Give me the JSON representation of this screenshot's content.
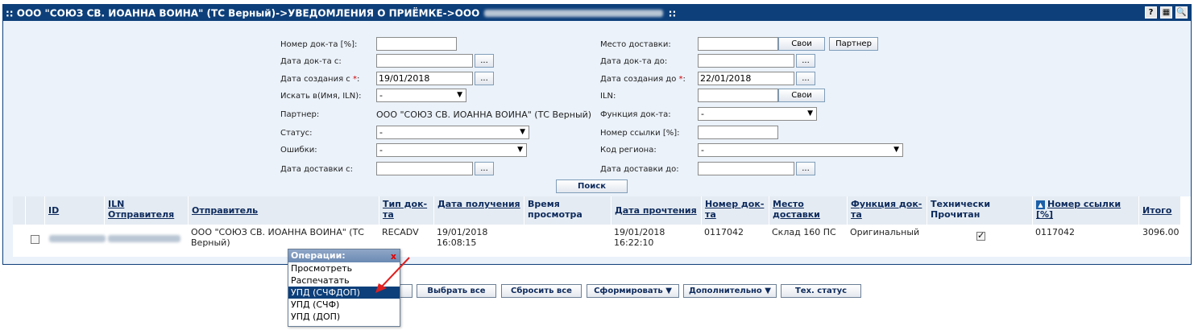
{
  "header": {
    "title_prefix": ":: ООО \"СОЮЗ СВ. ИОАННА ВОИНА\" (ТС Верный)->УВЕДОМЛЕНИЯ О ПРИЁМКЕ->ООО",
    "title_suffix": "::",
    "help_icon": "?",
    "grid_icon": "▦",
    "search_icon": "🔍"
  },
  "filters": {
    "doc_number_label": "Номер док-та [%]:",
    "doc_date_from_label": "Дата док-та с:",
    "created_from_label": "Дата создания с",
    "created_from_value": "19/01/2018",
    "search_in_label": "Искать в(Имя, ILN):",
    "search_in_value": "-",
    "partner_label": "Партнер:",
    "partner_value": "ООО \"СОЮЗ СВ. ИОАННА ВОИНА\" (ТС Верный)",
    "status_label": "Статус:",
    "status_value": "-",
    "errors_label": "Ошибки:",
    "errors_value": "-",
    "delivery_from_label": "Дата доставки с:",
    "delivery_place_label": "Место доставки:",
    "own_button": "Свои",
    "partner_button": "Партнер",
    "doc_date_to_label": "Дата док-та до:",
    "created_to_label": "Дата создания до",
    "created_to_value": "22/01/2018",
    "iln_label": "ILN:",
    "own_button2": "Свои",
    "doc_function_label": "Функция док-та:",
    "doc_function_value": "-",
    "ref_number_label": "Номер ссылки [%]:",
    "region_label": "Код региона:",
    "region_value": "-",
    "delivery_to_label": "Дата доставки до:",
    "ellipsis": "...",
    "required_mark": "*",
    "search_button": "Поиск"
  },
  "table": {
    "columns": {
      "id": "ID",
      "iln_sender": "ILN Отправителя",
      "sender": "Отправитель",
      "doc_type": "Тип док-та",
      "received_date": "Дата получения",
      "view_time": "Время просмотра",
      "read_date": "Дата прочтения",
      "doc_number": "Номер док-та",
      "delivery_place": "Место доставки",
      "doc_function": "Функция док-та",
      "tech_read": "Технически Прочитан",
      "ref_number": "Номер ссылки [%]",
      "total": "Итого"
    },
    "row": {
      "sender": "ООО \"СОЮЗ СВ. ИОАННА ВОИНА\" (ТС Верный)",
      "doc_type": "RECADV",
      "received_date": "19/01/2018 16:08:15",
      "view_time": "",
      "read_date": "19/01/2018 16:22:10",
      "doc_number": "0117042",
      "delivery_place": "Склад 160 ПС",
      "doc_function": "Оригинальный",
      "tech_read": true,
      "ref_number": "0117042",
      "total": "3096.00"
    }
  },
  "bottom_buttons": {
    "select_all": "Выбрать все",
    "reset_all": "Сбросить все",
    "generate": "Сформировать ▼",
    "more": "Дополнительно ▼",
    "tech_status": "Тех. статус"
  },
  "operations_popup": {
    "title": "Операции:",
    "close": "x",
    "items": [
      "Просмотреть",
      "Распечатать",
      "УПД (СЧФДОП)",
      "УПД (СЧФ)",
      "УПД (ДОП)"
    ],
    "active_index": 2
  },
  "colors": {
    "header_bg": "#0d3f7a",
    "panel_bg": "#ebf2fa",
    "arrow": "#e02020"
  }
}
